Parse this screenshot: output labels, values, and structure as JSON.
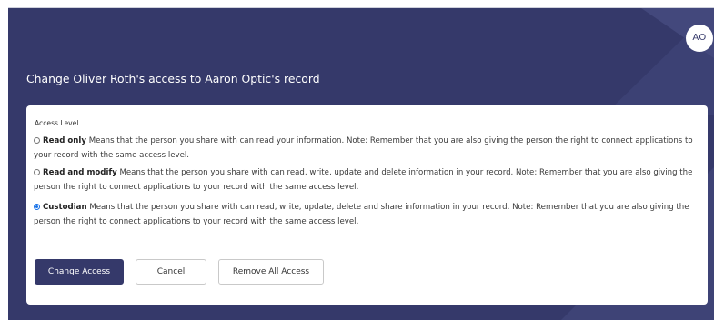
{
  "header": {
    "avatar_initials": "AO",
    "title": "Change Oliver Roth's access to Aaron Optic's record"
  },
  "form": {
    "access_level_label": "Access Level",
    "options": [
      {
        "name": "Read only",
        "description": "Means that the person you share with can read your information. Note: Remember that you are also giving the person the right to connect applications to your record with the same access level.",
        "selected": false
      },
      {
        "name": "Read and modify",
        "description": "Means that the person you share with can read, write, update and delete information in your record. Note: Remember that you are also giving the person the right to connect applications to your record with the same access level.",
        "selected": false
      },
      {
        "name": "Custodian",
        "description": "Means that the person you share with can read, write, update, delete and share information in your record. Note: Remember that you are also giving the person the right to connect applications to your record with the same access level.",
        "selected": true
      }
    ]
  },
  "actions": {
    "change_access_label": "Change Access",
    "cancel_label": "Cancel",
    "remove_all_label": "Remove All Access"
  },
  "colors": {
    "header_background": "#35396a",
    "primary_button": "#35396a",
    "radio_selected": "#1a73e8"
  }
}
